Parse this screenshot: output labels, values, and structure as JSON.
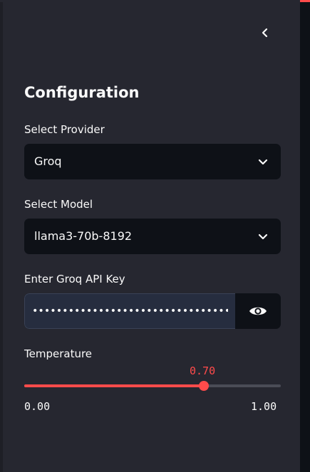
{
  "sidebar": {
    "title": "Configuration",
    "provider": {
      "label": "Select Provider",
      "value": "Groq"
    },
    "model": {
      "label": "Select Model",
      "value": "llama3-70b-8192"
    },
    "api_key": {
      "label": "Enter Groq API Key",
      "masked_value": "••••••••••••••••••••••••••••••••••••••••••••"
    },
    "temperature": {
      "label": "Temperature",
      "value_text": "0.70",
      "value": 0.7,
      "min": 0.0,
      "max": 1.0,
      "min_label": "0.00",
      "max_label": "1.00"
    }
  },
  "icons": {
    "collapse": "chevron-left-icon",
    "dropdown": "chevron-down-icon",
    "visibility": "eye-icon"
  },
  "colors": {
    "accent": "#ff4b4b",
    "sidebar_bg": "#262730",
    "input_bg": "#0e1117",
    "text": "#fafafa"
  }
}
